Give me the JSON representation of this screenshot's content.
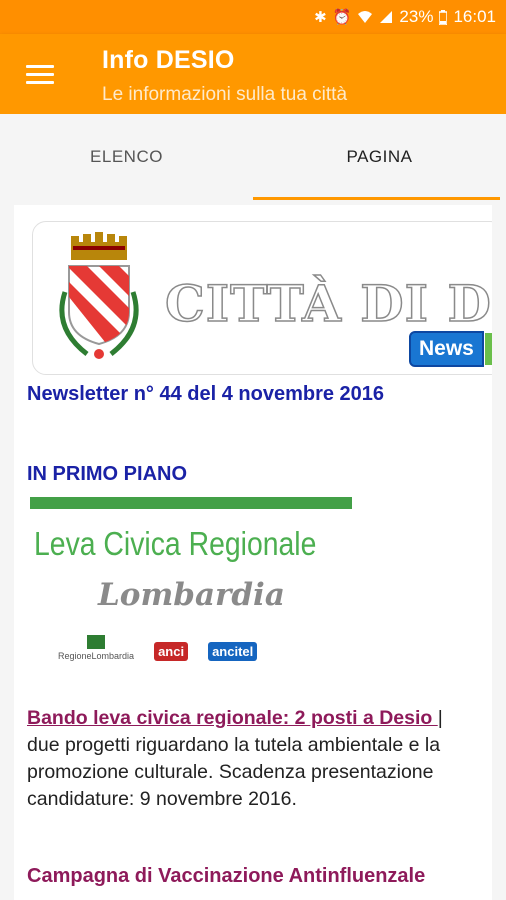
{
  "status_bar": {
    "battery": "23%",
    "time": "16:01",
    "icons": [
      "bluetooth-icon",
      "alarm-icon",
      "wifi-icon",
      "signal-icon",
      "battery-icon"
    ]
  },
  "app_bar": {
    "title": "Info DESIO",
    "subtitle": "Le informazioni sulla tua città",
    "menu_icon": "hamburger-menu-icon"
  },
  "tabs": [
    {
      "label": "ELENCO",
      "active": false
    },
    {
      "label": "PAGINA",
      "active": true
    }
  ],
  "content": {
    "banner": {
      "text": "CITTÀ DI DES",
      "badge": "News"
    },
    "newsletter_title": "Newsletter n° 44 del 4 novembre 2016",
    "section_title": "IN PRIMO PIANO",
    "image": {
      "title": "Leva Civica Regionale",
      "subtitle": "Lombardia",
      "logos": [
        "RegioneLombardia",
        "anci",
        "ancitel"
      ]
    },
    "article1": {
      "link": "Bando leva civica regionale: 2 posti a Desio ",
      "separator": "|",
      "body": "due progetti riguardano la tutela ambientale e la promozione culturale. Scadenza presentazione candidature: 9 novembre 2016."
    },
    "article2": {
      "link": "Campagna di Vaccinazione Antinfluenzale"
    }
  },
  "colors": {
    "primary": "#ff9800",
    "primary_dark": "#ff8f00",
    "heading_blue": "#1a22a6",
    "link_purple": "#8e1a5a"
  }
}
